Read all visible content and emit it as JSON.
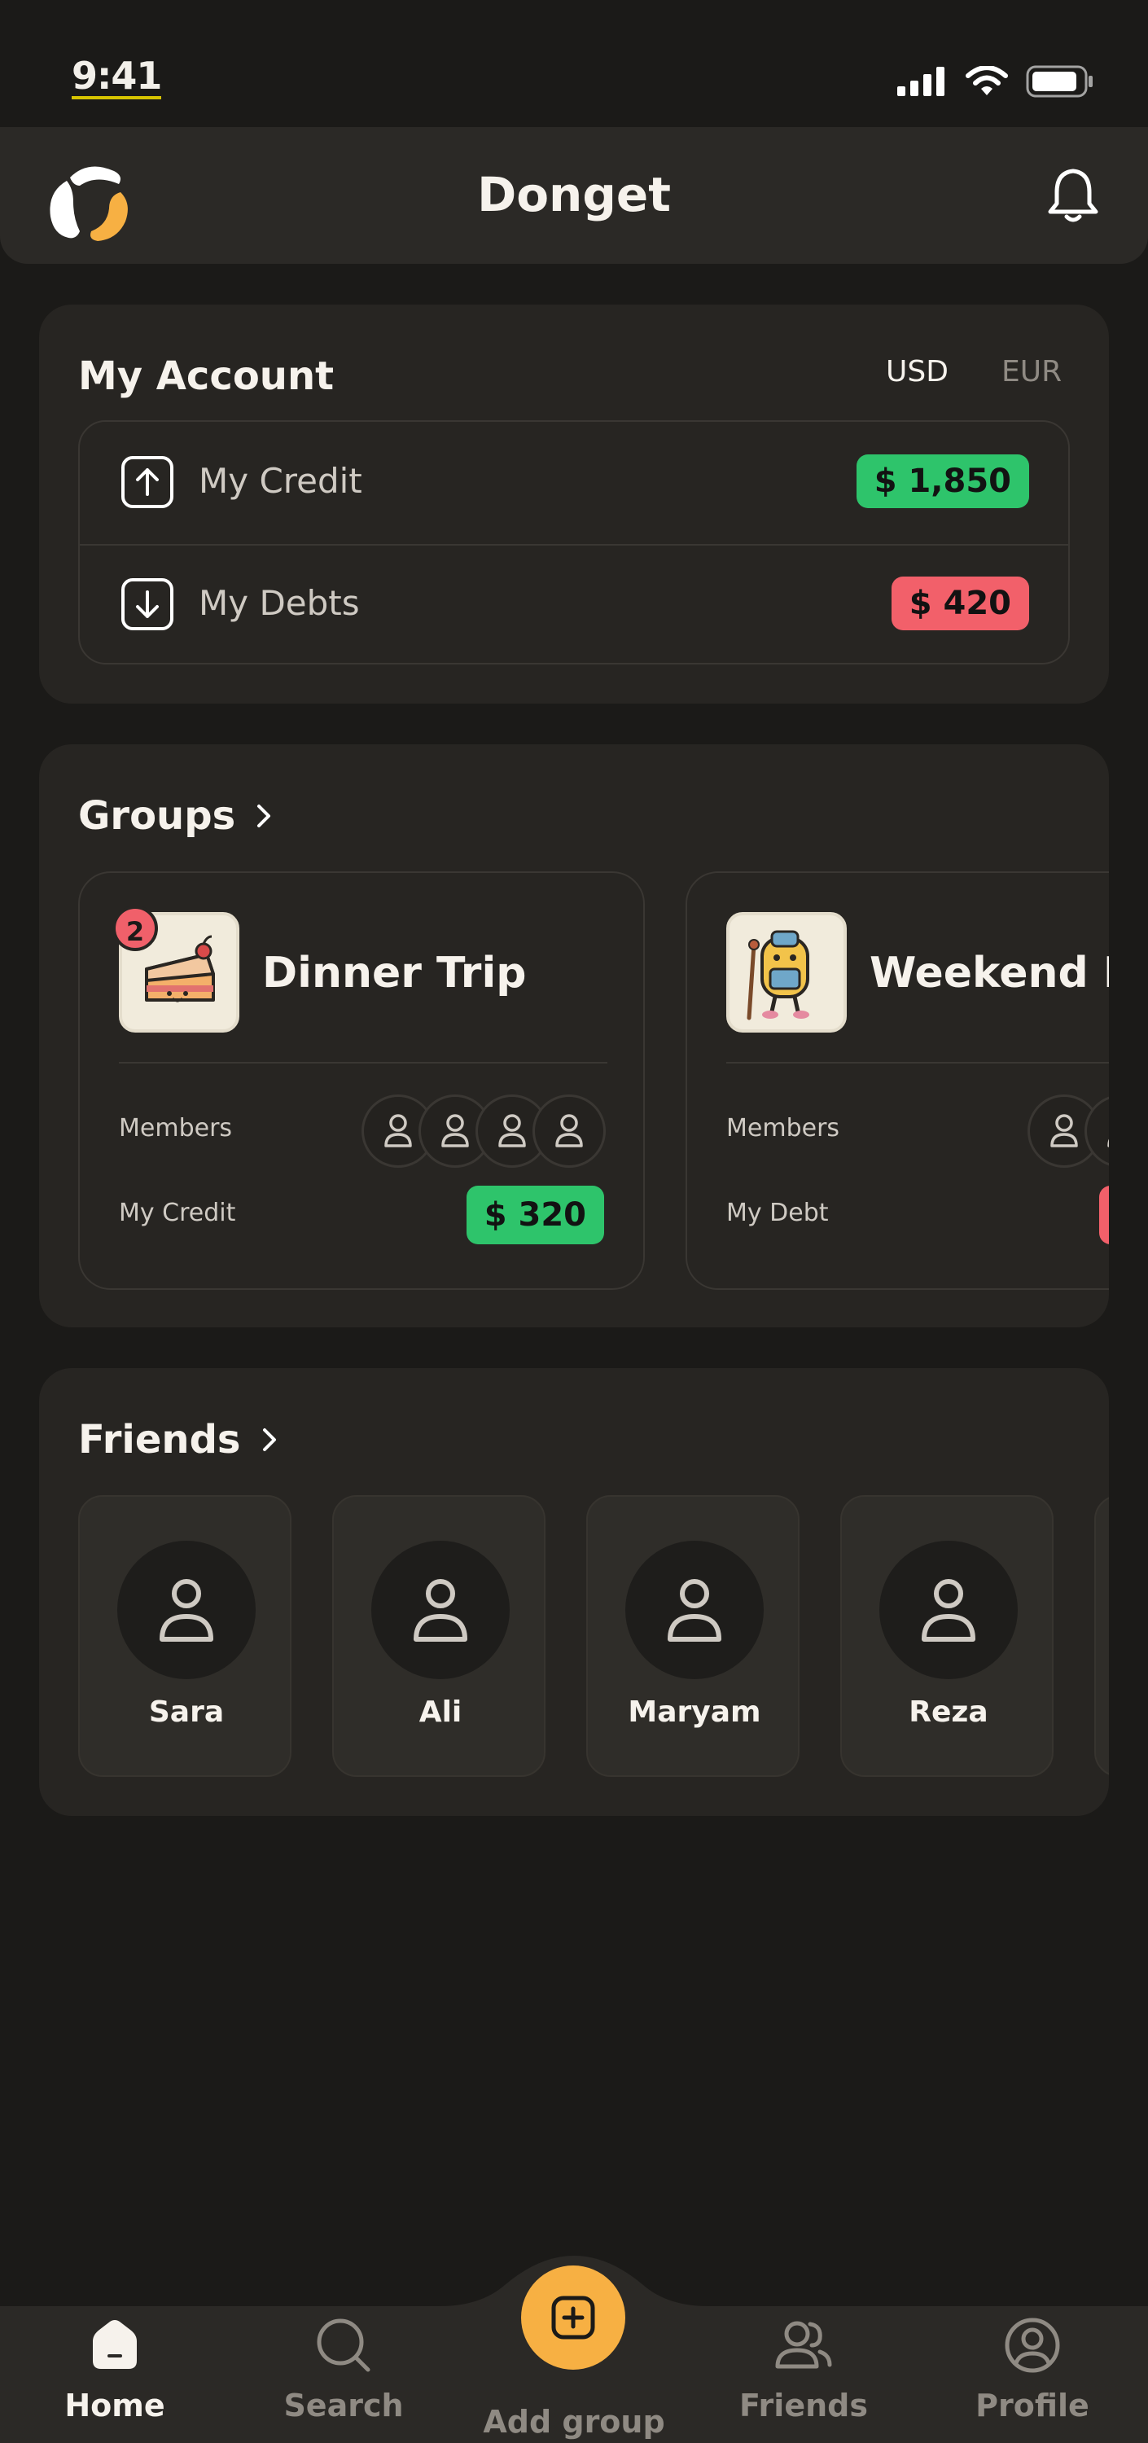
{
  "status_bar": {
    "time": "9:41"
  },
  "header": {
    "title": "Donget"
  },
  "account": {
    "title": "My Account",
    "currencies": [
      "USD",
      "EUR"
    ],
    "selected_currency": "USD",
    "rows": [
      {
        "label": "My Credit",
        "amount": "$ 1,850",
        "status": "credit"
      },
      {
        "label": "My Debts",
        "amount": "$ 420",
        "status": "debt"
      }
    ]
  },
  "groups": {
    "title": "Groups",
    "items": [
      {
        "name": "Dinner Trip",
        "badge": "2",
        "members_label": "Members",
        "balance_label": "My Credit",
        "amount": "$ 320",
        "status": "credit",
        "icon": "cake-icon"
      },
      {
        "name": "Weekend Hi",
        "members_label": "Members",
        "balance_label": "My Debt",
        "amount": "",
        "status": "debt",
        "icon": "hiker-icon"
      }
    ]
  },
  "friends": {
    "title": "Friends",
    "items": [
      {
        "name": "Sara"
      },
      {
        "name": "Ali"
      },
      {
        "name": "Maryam"
      },
      {
        "name": "Reza"
      }
    ]
  },
  "nav": {
    "items": [
      {
        "label": "Home",
        "icon": "home-icon",
        "active": true
      },
      {
        "label": "Search",
        "icon": "search-icon",
        "active": false
      },
      {
        "label": "Add group",
        "icon": "add-icon",
        "active": false
      },
      {
        "label": "Friends",
        "icon": "friends-icon",
        "active": false
      },
      {
        "label": "Profile",
        "icon": "profile-icon",
        "active": false
      }
    ]
  },
  "colors": {
    "background": "#1b1a18",
    "card": "#272522",
    "accent": "#f7b043",
    "credit": "#2ec46b",
    "debt": "#f2606a"
  }
}
